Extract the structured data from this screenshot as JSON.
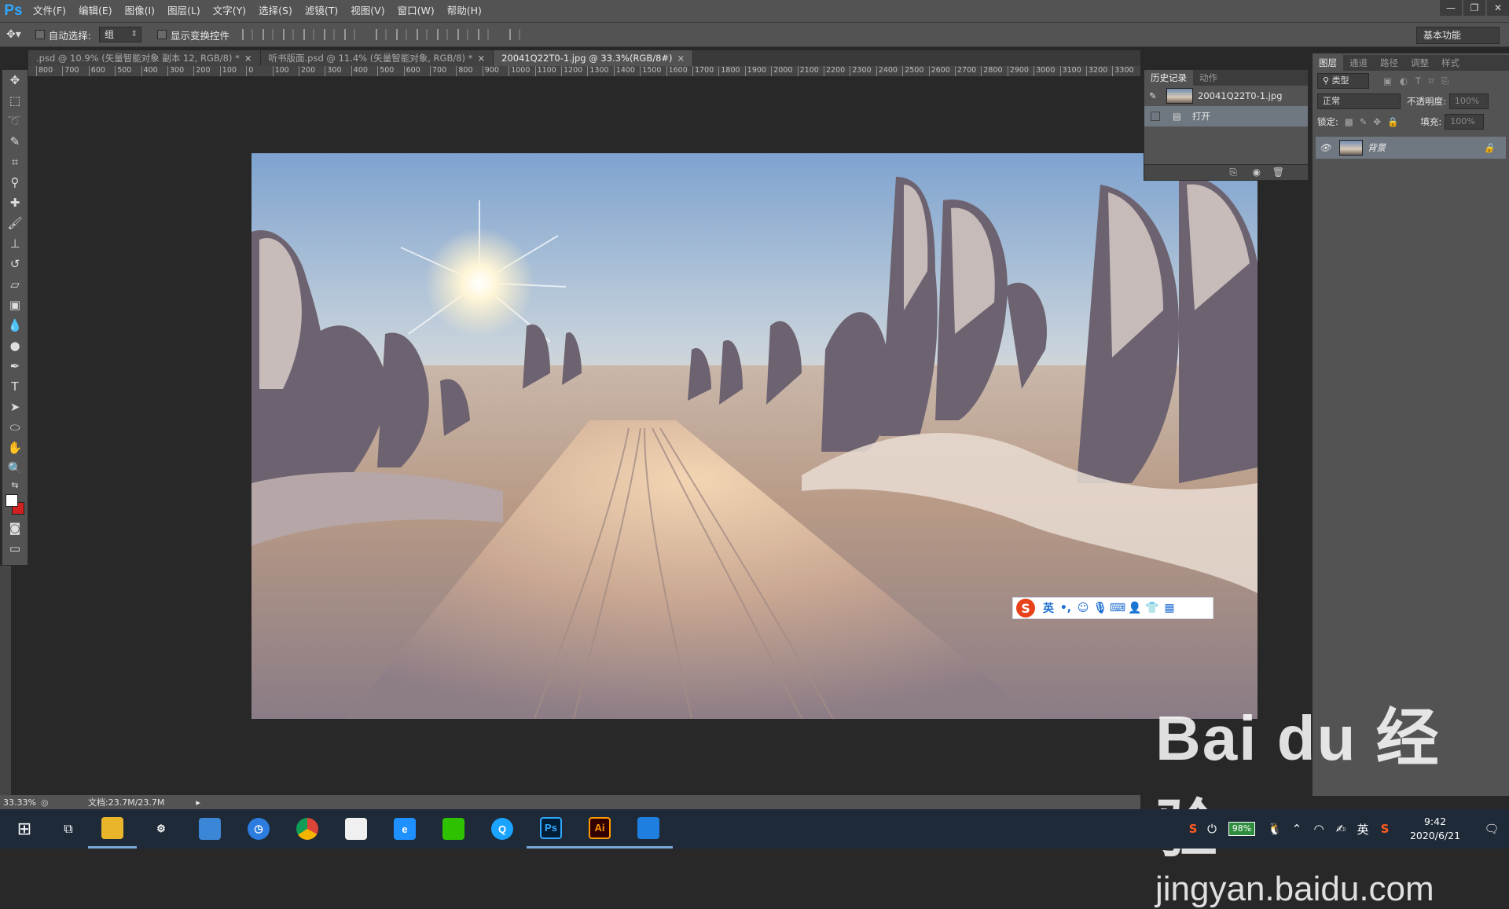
{
  "app": {
    "logo": "Ps",
    "menu": [
      "文件(F)",
      "编辑(E)",
      "图像(I)",
      "图层(L)",
      "文字(Y)",
      "选择(S)",
      "滤镜(T)",
      "视图(V)",
      "窗口(W)",
      "帮助(H)"
    ],
    "window_controls": [
      "—",
      "❐",
      "✕"
    ]
  },
  "options_bar": {
    "auto_select_label": "自动选择:",
    "auto_select_value": "组",
    "show_transform_label": "显示变换控件",
    "workspace": "基本功能"
  },
  "tabs": [
    {
      "label": ".psd @ 10.9% (矢量智能对象 副本 12, RGB/8) *",
      "active": false
    },
    {
      "label": "听书版面.psd @ 11.4% (矢量智能对象, RGB/8) *",
      "active": false
    },
    {
      "label": "20041Q22T0-1.jpg @ 33.3%(RGB/8#)",
      "active": true
    }
  ],
  "ruler_ticks": [
    "800",
    "700",
    "600",
    "500",
    "400",
    "300",
    "200",
    "100",
    "0",
    "100",
    "200",
    "300",
    "400",
    "500",
    "600",
    "700",
    "800",
    "900",
    "1000",
    "1100",
    "1200",
    "1300",
    "1400",
    "1500",
    "1600",
    "1700",
    "1800",
    "1900",
    "2000",
    "2100",
    "2200",
    "2300",
    "2400",
    "2500",
    "2600",
    "2700",
    "2800",
    "2900",
    "3000",
    "3100",
    "3200",
    "3300"
  ],
  "status": {
    "zoom": "33.33%",
    "doc": "文档:23.7M/23.7M"
  },
  "history_panel": {
    "tabs": [
      "历史记录",
      "动作"
    ],
    "snapshot": "20041Q22T0-1.jpg",
    "step": "打开"
  },
  "layers_panel": {
    "tabs": [
      "图层",
      "通道",
      "路径",
      "调整",
      "样式"
    ],
    "filter_kind": "类型",
    "blend_mode": "正常",
    "opacity_label": "不透明度:",
    "opacity_value": "100%",
    "lock_label": "锁定:",
    "fill_label": "填充:",
    "fill_value": "100%",
    "layer_name": "背景"
  },
  "ime": {
    "logo": "S",
    "lang": "英"
  },
  "taskbar": {
    "battery": "98%",
    "tray_lang": "英",
    "time": "9:42",
    "date": "2020/6/21",
    "apps": [
      {
        "name": "explorer",
        "label": "",
        "color": "#e9b62b",
        "running": true
      },
      {
        "name": "settings",
        "label": "⚙",
        "color": "transparent",
        "running": false
      },
      {
        "name": "photos",
        "label": "",
        "color": "#3b86d6",
        "running": false
      },
      {
        "name": "clock",
        "label": "◷",
        "color": "#2d7de0",
        "running": false
      },
      {
        "name": "chrome",
        "label": "",
        "color": "#db4437",
        "running": false
      },
      {
        "name": "store",
        "label": "",
        "color": "#f0f0f0",
        "running": false
      },
      {
        "name": "ie",
        "label": "e",
        "color": "#1e90ff",
        "running": false
      },
      {
        "name": "wechat",
        "label": "",
        "color": "#2dc100",
        "running": false
      },
      {
        "name": "qq-browser",
        "label": "Q",
        "color": "#1aa3ff",
        "running": false
      },
      {
        "name": "photoshop",
        "label": "Ps",
        "color": "#001e36",
        "running": true
      },
      {
        "name": "illustrator",
        "label": "Ai",
        "color": "#330000",
        "running": true
      },
      {
        "name": "phone",
        "label": "",
        "color": "#1e7fe0",
        "running": true
      }
    ]
  },
  "watermark": {
    "brand": "Bai du 经验",
    "url": "jingyan.baidu.com"
  }
}
